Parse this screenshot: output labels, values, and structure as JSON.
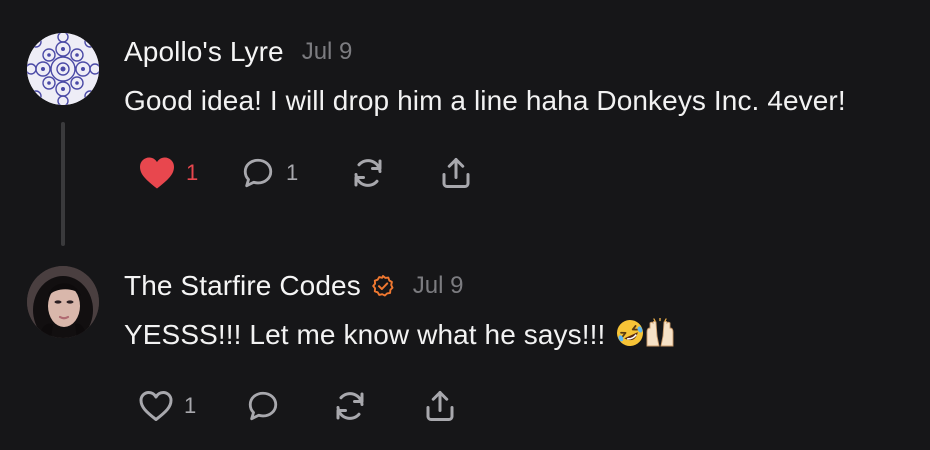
{
  "comments": [
    {
      "author": "Apollo's Lyre",
      "date": "Jul 9",
      "text": "Good idea! I will drop him a line haha Donkeys Inc. 4ever!",
      "likes": "1",
      "replies": "1",
      "liked": true,
      "avatar_icon": "mandala-avatar"
    },
    {
      "author": "The Starfire Codes",
      "date": "Jul 9",
      "text": "YESSS!!! Let me know what he says!!!",
      "emojis": [
        "rolling-laughing-emoji",
        "raised-hands-emoji"
      ],
      "likes": "1",
      "verified": true,
      "verified_color": "#f07830",
      "avatar_icon": "portrait-avatar"
    }
  ],
  "colors": {
    "background": "#161618",
    "like_active": "#e8474e",
    "muted": "#a8a8ad",
    "date": "#7c7c80"
  },
  "icons": [
    "heart-icon",
    "comment-icon",
    "restack-icon",
    "share-icon",
    "verified-badge-icon"
  ]
}
